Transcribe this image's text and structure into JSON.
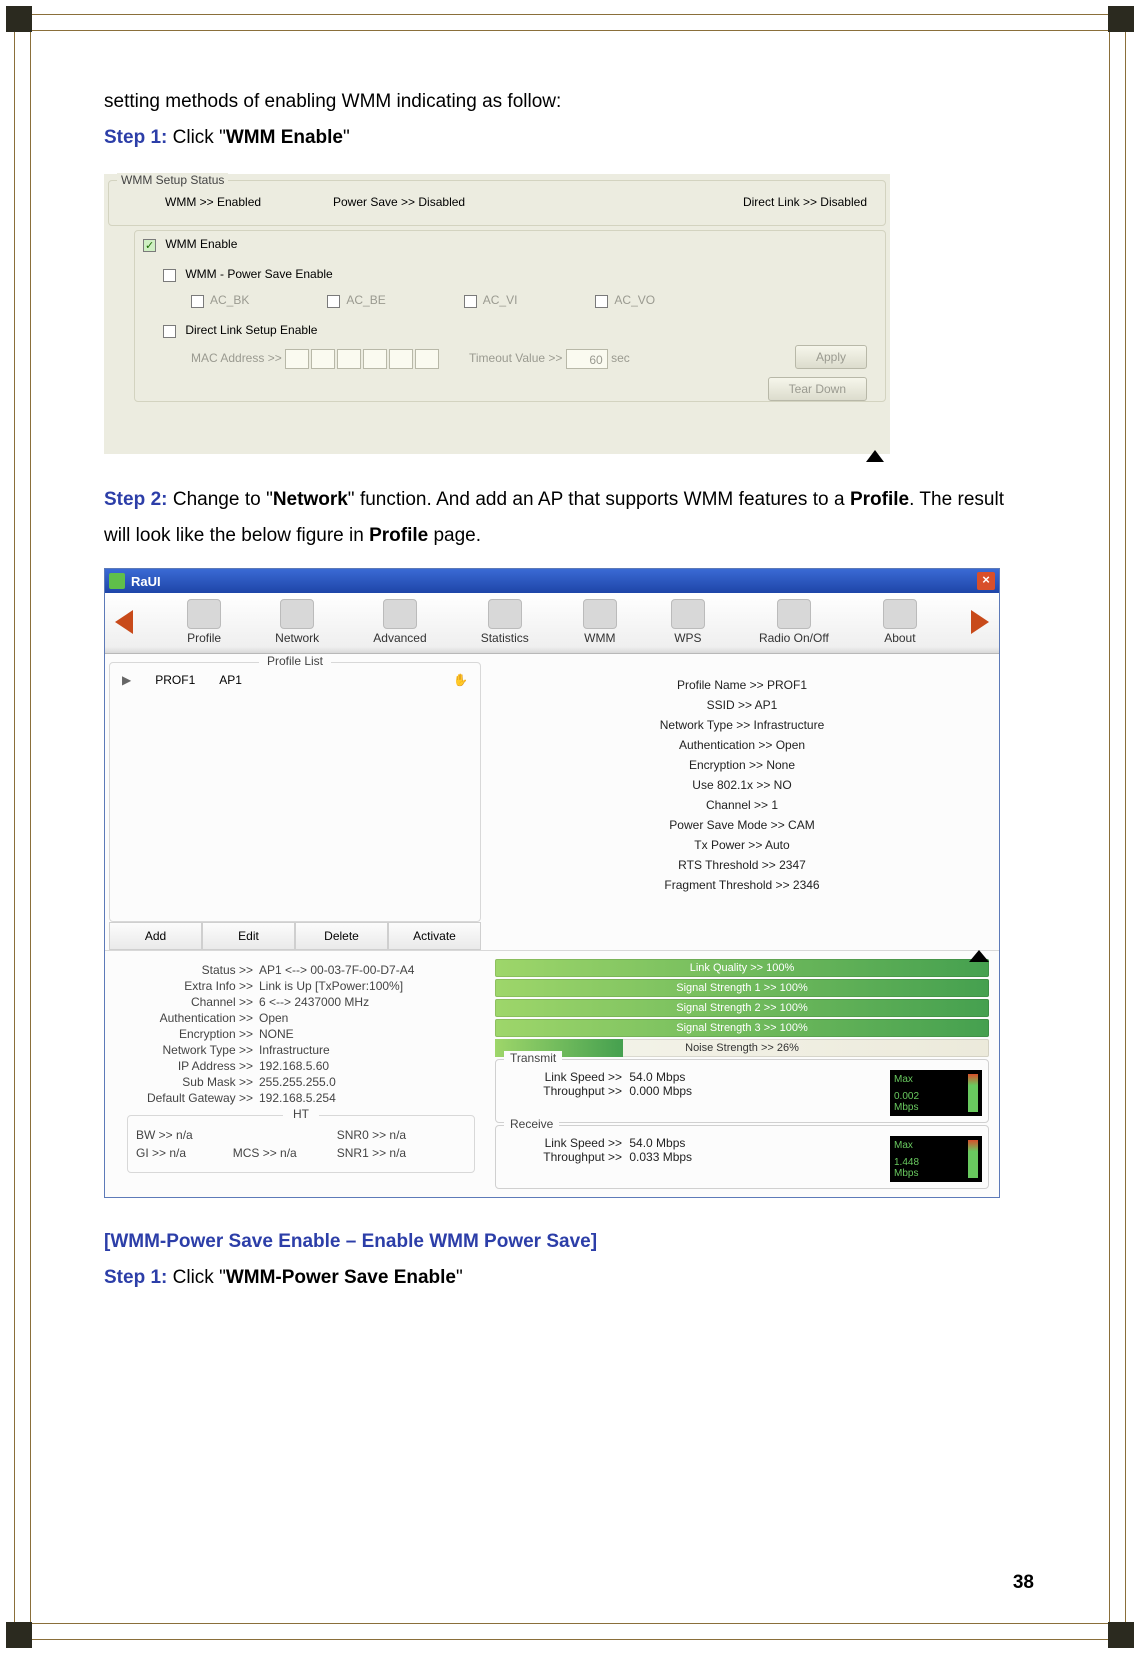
{
  "page": {
    "intro_line": "setting methods of enabling WMM indicating as follow:",
    "step1_label": "Step 1:",
    "step1_prefix": " Click \"",
    "step1_bold": "WMM Enable",
    "step1_suffix": "\"",
    "step2_label": "Step 2:",
    "step2_seg1": " Change to \"",
    "step2_bold1": "Network",
    "step2_seg2": "\" function. And add an AP that supports WMM features to a ",
    "step2_bold2": "Profile",
    "step2_seg3": ". The result will look like the below figure in ",
    "step2_bold3": "Profile",
    "step2_seg4": " page.",
    "section_heading": "[WMM-Power Save Enable – Enable WMM Power Save]",
    "step1b_label": "Step 1:",
    "step1b_prefix": " Click \"",
    "step1b_bold": "WMM-Power Save Enable",
    "step1b_suffix": "\"",
    "page_number": "38"
  },
  "wmm": {
    "fs_title": "WMM Setup Status",
    "status_wmm": "WMM >> Enabled",
    "status_ps": "Power Save >> Disabled",
    "status_dl": "Direct Link >> Disabled",
    "chk_wmm_enable": "WMM Enable",
    "chk_ps_enable": "WMM - Power Save Enable",
    "ac_bk": "AC_BK",
    "ac_be": "AC_BE",
    "ac_vi": "AC_VI",
    "ac_vo": "AC_VO",
    "chk_dl_enable": "Direct Link Setup Enable",
    "mac_label": "MAC Address >>",
    "timeout_label": "Timeout Value >>",
    "timeout_value": "60",
    "timeout_unit": "sec",
    "btn_apply": "Apply",
    "btn_teardown": "Tear Down"
  },
  "raui": {
    "title": "RaUI",
    "tabs": {
      "profile": "Profile",
      "network": "Network",
      "advanced": "Advanced",
      "statistics": "Statistics",
      "wmm": "WMM",
      "wps": "WPS",
      "radio": "Radio On/Off",
      "about": "About"
    },
    "profile_list_label": "Profile List",
    "profile_row": {
      "name": "PROF1",
      "ssid": "AP1"
    },
    "actions": {
      "add": "Add",
      "edit": "Edit",
      "delete": "Delete",
      "activate": "Activate"
    },
    "details": {
      "profile_name": "Profile Name >> PROF1",
      "ssid": "SSID >> AP1",
      "network_type": "Network Type >> Infrastructure",
      "auth": "Authentication >> Open",
      "encryption": "Encryption >> None",
      "use8021x": "Use 802.1x >> NO",
      "channel": "Channel >> 1",
      "psm": "Power Save Mode >> CAM",
      "txpower": "Tx Power >> Auto",
      "rts": "RTS Threshold >> 2347",
      "frag": "Fragment Threshold >> 2346"
    },
    "status_left": {
      "status_label": "Status >>",
      "status_value": "AP1 <--> 00-03-7F-00-D7-A4",
      "extra_label": "Extra Info >>",
      "extra_value": "Link is Up [TxPower:100%]",
      "channel_label": "Channel >>",
      "channel_value": "6 <--> 2437000 MHz",
      "auth_label": "Authentication >>",
      "auth_value": "Open",
      "enc_label": "Encryption >>",
      "enc_value": "NONE",
      "ntype_label": "Network Type >>",
      "ntype_value": "Infrastructure",
      "ip_label": "IP Address >>",
      "ip_value": "192.168.5.60",
      "sub_label": "Sub Mask >>",
      "sub_value": "255.255.255.0",
      "gw_label": "Default Gateway >>",
      "gw_value": "192.168.5.254"
    },
    "ht": {
      "title": "HT",
      "bw": "BW >> n/a",
      "gi": "GI >> n/a",
      "mcs": "MCS >> n/a",
      "snr0": "SNR0 >> n/a",
      "snr1": "SNR1 >> n/a"
    },
    "bars": {
      "lq": "Link Quality >> 100%",
      "ss1": "Signal Strength 1 >> 100%",
      "ss2": "Signal Strength 2 >> 100%",
      "ss3": "Signal Strength 3 >> 100%",
      "noise": "Noise Strength >> 26%"
    },
    "transmit": {
      "title": "Transmit",
      "link_speed_label": "Link Speed >>",
      "link_speed_value": "54.0 Mbps",
      "throughput_label": "Throughput >>",
      "throughput_value": "0.000 Mbps",
      "gauge_top": "Max",
      "gauge_val": "0.002",
      "gauge_unit": "Mbps"
    },
    "receive": {
      "title": "Receive",
      "link_speed_label": "Link Speed >>",
      "link_speed_value": "54.0 Mbps",
      "throughput_label": "Throughput >>",
      "throughput_value": "0.033 Mbps",
      "gauge_top": "Max",
      "gauge_val": "1.448",
      "gauge_unit": "Mbps"
    }
  }
}
